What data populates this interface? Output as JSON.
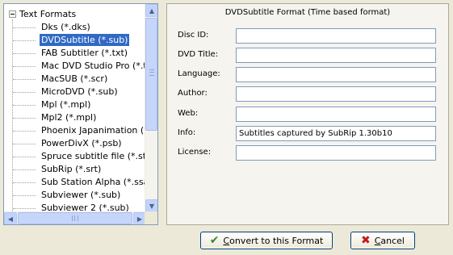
{
  "tree": {
    "root_label": "Text Formats",
    "items": [
      {
        "label": "Dks (*.dks)"
      },
      {
        "label": "DVDSubtitle (*.sub)",
        "selected": true
      },
      {
        "label": "FAB Subtitler (*.txt)"
      },
      {
        "label": "Mac DVD Studio Pro (*.txt)"
      },
      {
        "label": "MacSUB (*.scr)"
      },
      {
        "label": "MicroDVD (*.sub)"
      },
      {
        "label": "Mpl (*.mpl)"
      },
      {
        "label": "Mpl2 (*.mpl)"
      },
      {
        "label": "Phoenix Japanimation (*.pjs)"
      },
      {
        "label": "PowerDivX (*.psb)"
      },
      {
        "label": "Spruce subtitle file (*.stl)"
      },
      {
        "label": "SubRip (*.srt)"
      },
      {
        "label": "Sub Station Alpha (*.ssa)"
      },
      {
        "label": "Subviewer (*.sub)"
      },
      {
        "label": "Subviewer 2 (*.sub)"
      }
    ]
  },
  "panel": {
    "title": "DVDSubtitle Format (Time based format)",
    "fields": [
      {
        "label": "Disc ID:",
        "value": ""
      },
      {
        "label": "DVD Title:",
        "value": ""
      },
      {
        "label": "Language:",
        "value": ""
      },
      {
        "label": "Author:",
        "value": ""
      },
      {
        "label": "Web:",
        "value": ""
      },
      {
        "label": "Info:",
        "value": "Subtitles captured by SubRip 1.30b10"
      },
      {
        "label": "License:",
        "value": ""
      }
    ]
  },
  "buttons": {
    "convert_first": "C",
    "convert_rest": "onvert to this Format",
    "cancel_first": "C",
    "cancel_rest": "ancel"
  },
  "colors": {
    "selection": "#316ac5",
    "window_bg": "#ece9d8",
    "input_border": "#7f9db9"
  },
  "icons": {
    "convert": "checkmark-icon",
    "cancel": "x-icon",
    "expander": "minus-box-icon"
  }
}
